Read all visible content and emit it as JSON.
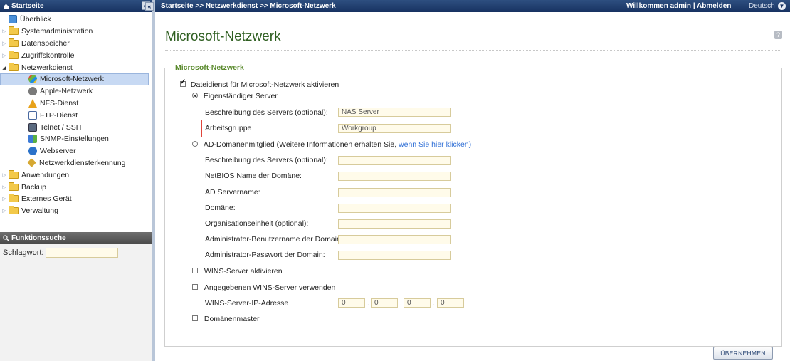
{
  "sidebar": {
    "header": "Startseite",
    "collapse": "«",
    "items": [
      {
        "label": "Überblick"
      },
      {
        "label": "Systemadministration"
      },
      {
        "label": "Datenspeicher"
      },
      {
        "label": "Zugriffskontrolle"
      },
      {
        "label": "Netzwerkdienst"
      },
      {
        "label": "Microsoft-Netzwerk"
      },
      {
        "label": "Apple-Netzwerk"
      },
      {
        "label": "NFS-Dienst"
      },
      {
        "label": "FTP-Dienst"
      },
      {
        "label": "Telnet / SSH"
      },
      {
        "label": "SNMP-Einstellungen"
      },
      {
        "label": "Webserver"
      },
      {
        "label": "Netzwerkdiensterkennung"
      },
      {
        "label": "Anwendungen"
      },
      {
        "label": "Backup"
      },
      {
        "label": "Externes Gerät"
      },
      {
        "label": "Verwaltung"
      }
    ],
    "search": {
      "header": "Funktionssuche",
      "label": "Schlagwort:",
      "value": ""
    }
  },
  "topbar": {
    "breadcrumb": "Startseite >> Netzwerkdienst >> Microsoft-Netzwerk",
    "welcome": "Willkommen admin | Abmelden",
    "language": "Deutsch"
  },
  "main": {
    "title": "Microsoft-Netzwerk",
    "legend": "Microsoft-Netzwerk",
    "enable_label": "Dateidienst für Microsoft-Netzwerk aktivieren",
    "standalone_label": "Eigenständiger Server",
    "standalone": {
      "server_desc_label": "Beschreibung des Servers (optional):",
      "server_desc_value": "NAS Server",
      "workgroup_label": "Arbeitsgruppe",
      "workgroup_value": "Workgroup"
    },
    "ad_label": "AD-Domänenmitglied (Weitere Informationen erhalten Sie,",
    "ad_link": "wenn Sie hier klicken)",
    "ad": {
      "server_desc_label": "Beschreibung des Servers (optional):",
      "netbios_label": "NetBIOS Name der Domäne:",
      "ad_servername_label": "AD Servername:",
      "domain_label": "Domäne:",
      "ou_label": "Organisationseinheit (optional):",
      "admin_user_label": "Administrator-Benutzername der Domain:",
      "admin_pass_label": "Administrator-Passwort der Domain:"
    },
    "wins_enable_label": "WINS-Server aktivieren",
    "wins_use_label": "Angegebenen WINS-Server verwenden",
    "wins_ip_label": "WINS-Server-IP-Adresse",
    "wins_ip": [
      "0",
      "0",
      "0",
      "0"
    ],
    "domain_master_label": "Domänenmaster",
    "apply": "ÜBERNEHMEN"
  }
}
